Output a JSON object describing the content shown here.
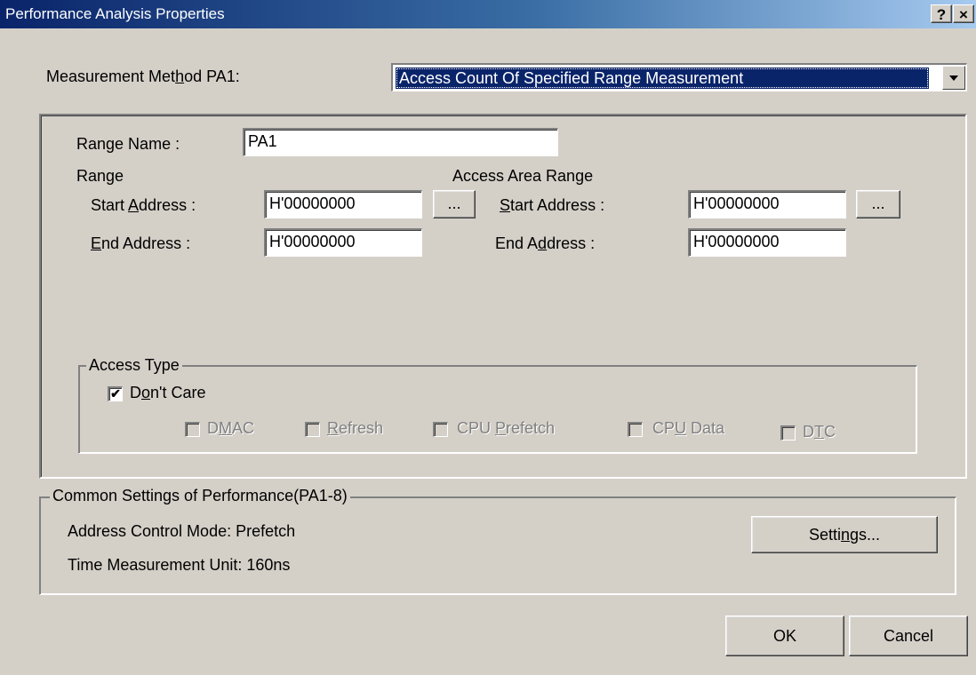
{
  "window": {
    "title": "Performance Analysis Properties",
    "help_button": "?",
    "close_button": "×"
  },
  "measurement": {
    "label_pre": "Measurement Met",
    "label_access": "h",
    "label_post": "od PA1:",
    "selected": "Access Count Of Specified Range Measurement"
  },
  "range_name": {
    "label_pre": "Ran",
    "label_access": "g",
    "label_post": "e Name :",
    "value": "PA1"
  },
  "range": {
    "heading": "Range",
    "start_label_pre": "Start ",
    "start_label_access": "A",
    "start_label_post": "ddress :",
    "start_value": "H'00000000",
    "end_label_access": "E",
    "end_label_post": "nd Address :",
    "end_value": "H'00000000",
    "browse_label": "..."
  },
  "access_area": {
    "heading": "Access Area Range",
    "start_label_access": "S",
    "start_label_post": "tart Address :",
    "start_value": "H'00000000",
    "end_label_pre": "End A",
    "end_label_access": "d",
    "end_label_post": "dress :",
    "end_value": "H'00000000",
    "browse_label": "..."
  },
  "access_type": {
    "legend": "Access Type",
    "dont_care": {
      "pre": "D",
      "access": "o",
      "post": "n't Care",
      "checked": true,
      "check_glyph": "✔"
    },
    "options": [
      {
        "pre": "D",
        "access": "M",
        "post": "AC"
      },
      {
        "pre": "",
        "access": "R",
        "post": "efresh"
      },
      {
        "pre": "CPU ",
        "access": "P",
        "post": "refetch"
      },
      {
        "pre": "CP",
        "access": "U",
        "post": " Data"
      },
      {
        "pre": "D",
        "access": "T",
        "post": "C"
      }
    ]
  },
  "common": {
    "legend": "Common Settings of Performance(PA1-8)",
    "address_mode": "Address Control Mode: Prefetch",
    "time_unit": "Time Measurement Unit: 160ns",
    "settings_pre": "Setti",
    "settings_access": "n",
    "settings_post": "gs..."
  },
  "buttons": {
    "ok": "OK",
    "cancel": "Cancel"
  }
}
